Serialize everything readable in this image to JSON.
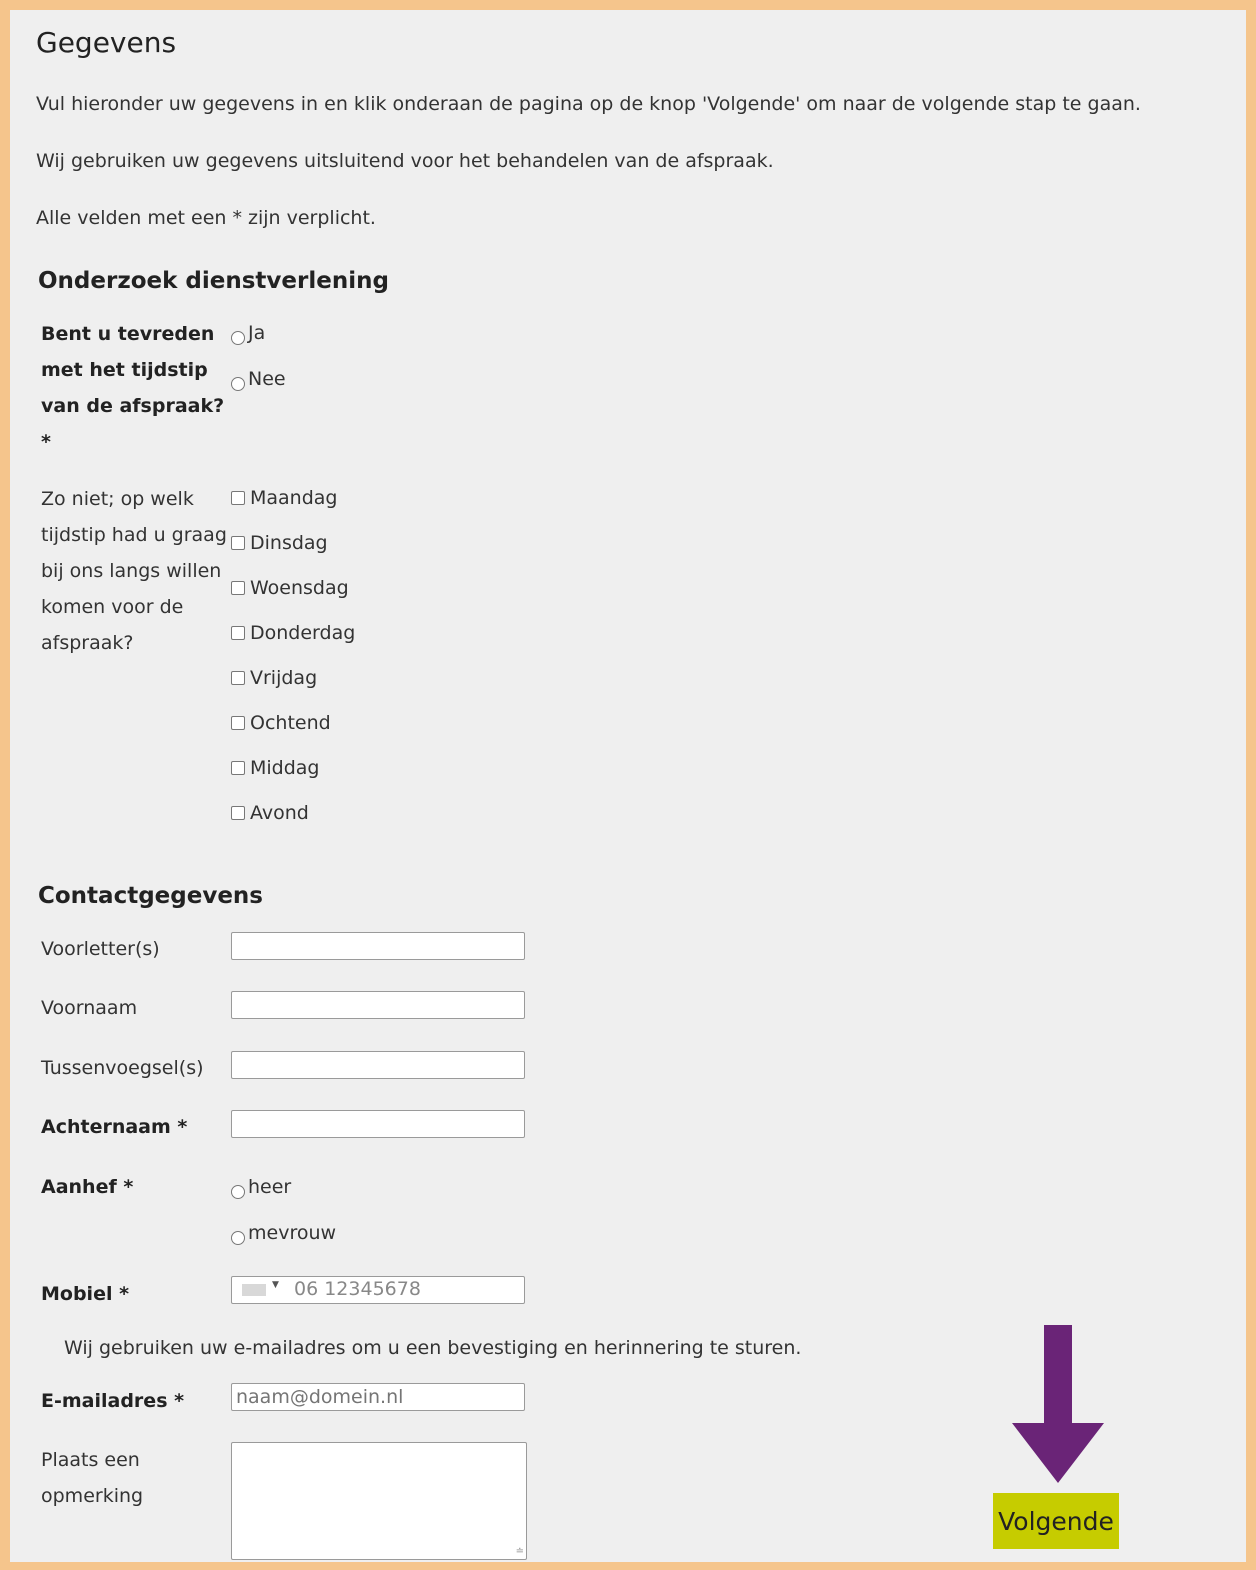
{
  "page": {
    "title": "Gegevens",
    "intro": [
      "Vul hieronder uw gegevens in en klik onderaan de pagina op de knop 'Volgende' om naar de volgende stap te gaan.",
      "Wij gebruiken uw gegevens uitsluitend voor het behandelen van de afspraak.",
      "Alle velden met een * zijn verplicht."
    ]
  },
  "survey": {
    "heading": "Onderzoek dienstverlening",
    "satisfied": {
      "label": "Bent u tevreden met het tijdstip van de afspraak? *",
      "options": [
        "Ja",
        "Nee"
      ]
    },
    "preferred": {
      "label": "Zo niet; op welk tijdstip had u graag bij ons langs willen komen voor de afspraak?",
      "options": [
        "Maandag",
        "Dinsdag",
        "Woensdag",
        "Donderdag",
        "Vrijdag",
        "Ochtend",
        "Middag",
        "Avond"
      ]
    }
  },
  "contact": {
    "heading": "Contactgegevens",
    "voorletters_label": "Voorletter(s)",
    "voornaam_label": "Voornaam",
    "tussenvoegsel_label": "Tussenvoegsel(s)",
    "achternaam_label": "Achternaam *",
    "aanhef": {
      "label": "Aanhef *",
      "options": [
        "heer",
        "mevrouw"
      ]
    },
    "mobiel": {
      "label": "Mobiel *",
      "placeholder": "06 12345678"
    },
    "email_note": "Wij gebruiken uw e-mailadres om u een bevestiging en herinnering te sturen.",
    "email": {
      "label": "E-mailadres *",
      "placeholder": "naam@domein.nl"
    },
    "opmerking_label": "Plaats een opmerking"
  },
  "actions": {
    "next_label": "Volgende"
  },
  "colors": {
    "outer_border": "#f5c58c",
    "background": "#efefef",
    "arrow": "#6a2477",
    "button": "#c6cc00"
  },
  "icons": {
    "arrow": "arrow-down-icon",
    "flag": "flag-icon",
    "resize": "resize-grip-icon"
  }
}
